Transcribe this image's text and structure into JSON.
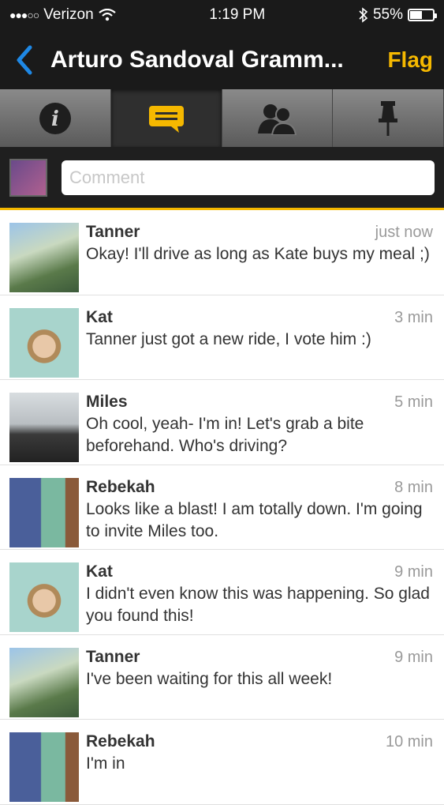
{
  "status": {
    "carrier": "Verizon",
    "time": "1:19 PM",
    "battery": "55%",
    "battery_level": 0.55
  },
  "nav": {
    "back_icon": "chevron-left-icon",
    "title": "Arturo Sandoval Gramm...",
    "flag_label": "Flag"
  },
  "tabs": [
    {
      "icon": "info-icon",
      "active": false
    },
    {
      "icon": "chat-bubble-icon",
      "active": true
    },
    {
      "icon": "people-icon",
      "active": false
    },
    {
      "icon": "pushpin-icon",
      "active": false
    }
  ],
  "comment": {
    "placeholder": "Comment",
    "value": ""
  },
  "colors": {
    "accent": "#f5b800",
    "back": "#1e88e5",
    "bar": "#1a1a1a"
  },
  "comments": [
    {
      "name": "Tanner",
      "time": "just now",
      "text": "Okay! I'll drive as long as Kate buys my meal ;)"
    },
    {
      "name": "Kat",
      "time": "3 min",
      "text": "Tanner just got a new ride, I vote him :)"
    },
    {
      "name": "Miles",
      "time": "5 min",
      "text": "Oh cool, yeah- I'm in!  Let's grab a bite beforehand. Who's driving?"
    },
    {
      "name": "Rebekah",
      "time": "8 min",
      "text": "Looks like a blast! I am totally down.  I'm going to invite Miles too."
    },
    {
      "name": "Kat",
      "time": "9 min",
      "text": "I didn't even know this was happening. So glad you found this!"
    },
    {
      "name": "Tanner",
      "time": "9 min",
      "text": "I've been waiting for this all week!"
    },
    {
      "name": "Rebekah",
      "time": "10 min",
      "text": "I'm in"
    }
  ]
}
